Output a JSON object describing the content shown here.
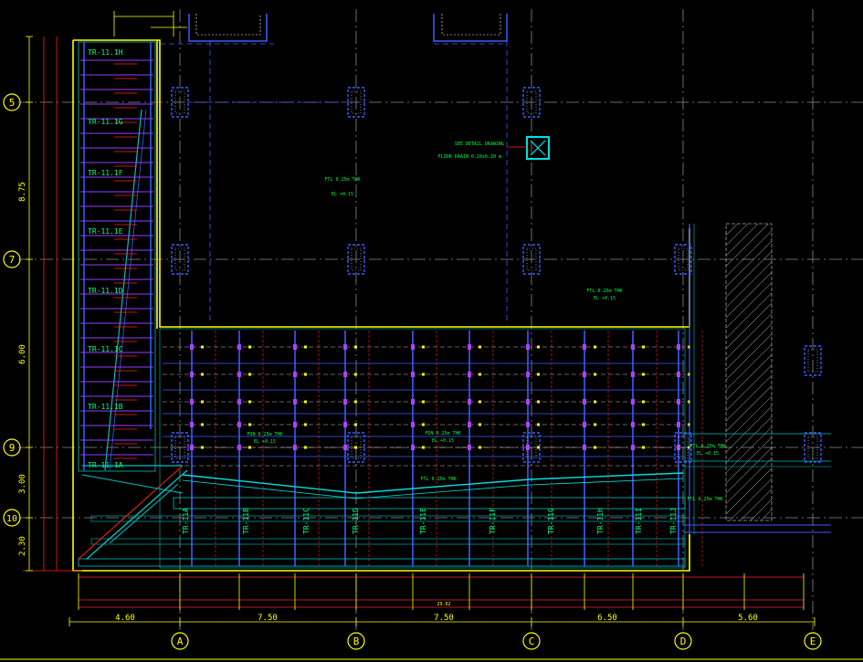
{
  "drawing": {
    "grid_rows": [
      {
        "id": "row-5",
        "label": "5"
      },
      {
        "id": "row-7",
        "label": "7"
      },
      {
        "id": "row-9",
        "label": "9"
      },
      {
        "id": "row-10",
        "label": "10"
      }
    ],
    "grid_cols": [
      {
        "id": "col-A",
        "label": "A"
      },
      {
        "id": "col-B",
        "label": "B"
      },
      {
        "id": "col-C",
        "label": "C"
      },
      {
        "id": "col-D",
        "label": "D"
      },
      {
        "id": "col-E",
        "label": "E"
      }
    ],
    "left_dims": [
      "8.75",
      "6.00",
      "3.00",
      "2.30"
    ],
    "bottom_dims": [
      "4.60",
      "7.50",
      "7.50",
      "6.50",
      "5.60"
    ],
    "trench_labels_left": [
      "TR-11.1H",
      "TR-11.1G",
      "TR-11.1F",
      "TR-11.1E",
      "TR-11.1D",
      "TR-11.1C",
      "TR-11.1B",
      "TR-11.1A"
    ],
    "trench_labels_bottom": [
      "TR-11A",
      "TR-11B",
      "TR-11C",
      "TR-11D",
      "TR-11E",
      "TR-11F",
      "TR-11G",
      "TR-11H",
      "TR-11I",
      "TR-11J"
    ],
    "notes": {
      "ftl_main": "FTL 0.25m THK",
      "ftl_main_2": "EL +0.15",
      "ftl_right": "FTL 0.25m THK",
      "ftl_right_2": "EL +0.15",
      "fdn_mid": "FDN 0.25m THK",
      "fdn_mid_2": "EL +0.15",
      "fdn_left": "FDN 0.25m THK",
      "fdn_left_2": "EL +0.15",
      "ftl_lower": "FTL 0.25m THK",
      "ftl_right_edge": "FTL 0.25m THK",
      "ftl_right_edge_2": "EL +0.15",
      "ftl_bottom_right": "FTL 0.25m THK",
      "pit_note": "SEE DETAIL DRAWING",
      "pit_note_2": "FLOOR DRAIN 0.20x0.20 m."
    },
    "overall_dim": "29.62"
  }
}
